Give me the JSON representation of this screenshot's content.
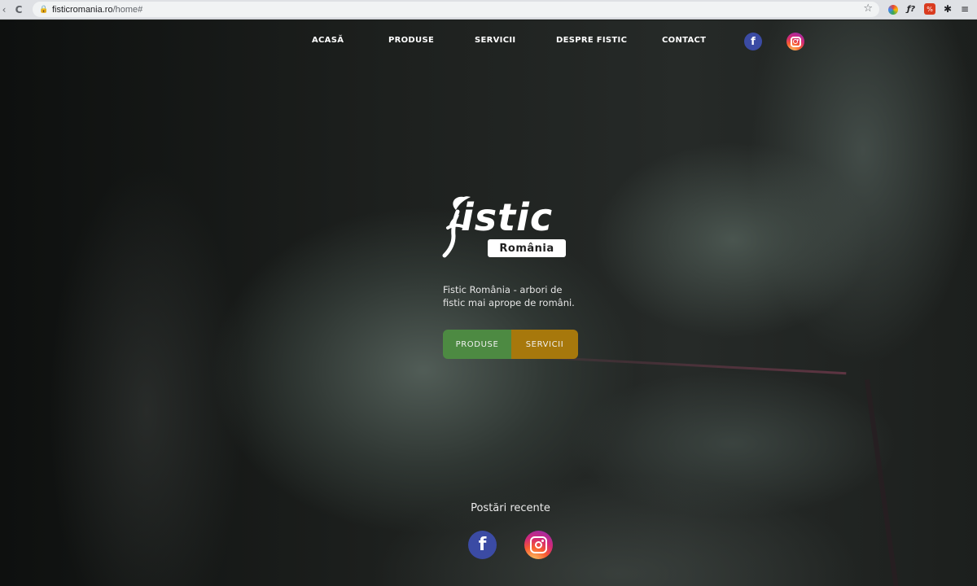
{
  "browser": {
    "url_host": "fisticromania.ro",
    "url_path": "/home#",
    "nav_icons": {
      "back": "‹",
      "reload": "C"
    }
  },
  "nav": {
    "items": [
      "ACASĂ",
      "PRODUSE",
      "SERVICII",
      "DESPRE FISTIC",
      "CONTACT"
    ],
    "social": [
      {
        "name": "facebook-icon",
        "glyph": "f"
      },
      {
        "name": "instagram-icon"
      }
    ]
  },
  "logo": {
    "word": "istic",
    "badge": "România"
  },
  "hero": {
    "tagline": "Fistic România - arbori de fistic mai aprope de români.",
    "buttons": {
      "produse": "PRODUSE",
      "servicii": "SERVICII"
    },
    "recent_title": "Postări recente",
    "social_glyph": "f"
  },
  "colors": {
    "produse_button": "#4d8a42",
    "servicii_button": "#a7780c",
    "facebook": "#3b4ba4"
  }
}
